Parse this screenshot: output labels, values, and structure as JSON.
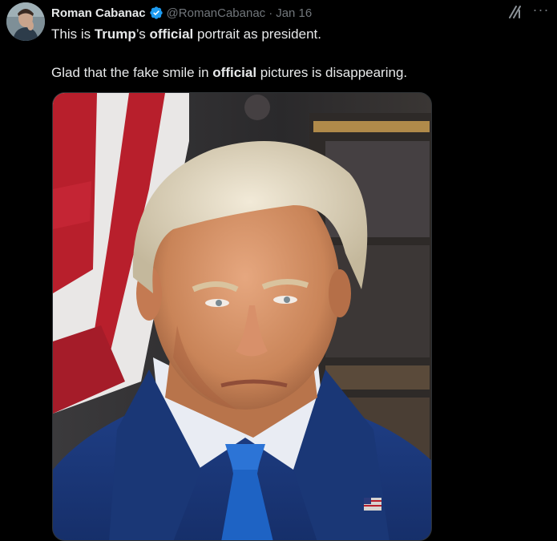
{
  "tweet": {
    "author_name": "Roman Cabanac",
    "handle": "@RomanCabanac",
    "separator": "·",
    "date": "Jan 16",
    "text_line1": {
      "p1": "This is ",
      "b1": "Trump",
      "p2": "’s ",
      "b2": "official",
      "p3": " portrait as president."
    },
    "text_line2": {
      "p1": "Glad that the fake smile in ",
      "b1": "official",
      "p2": " pictures is disappearing."
    },
    "more_label": "···",
    "verified_color": "#1d9bf0"
  }
}
